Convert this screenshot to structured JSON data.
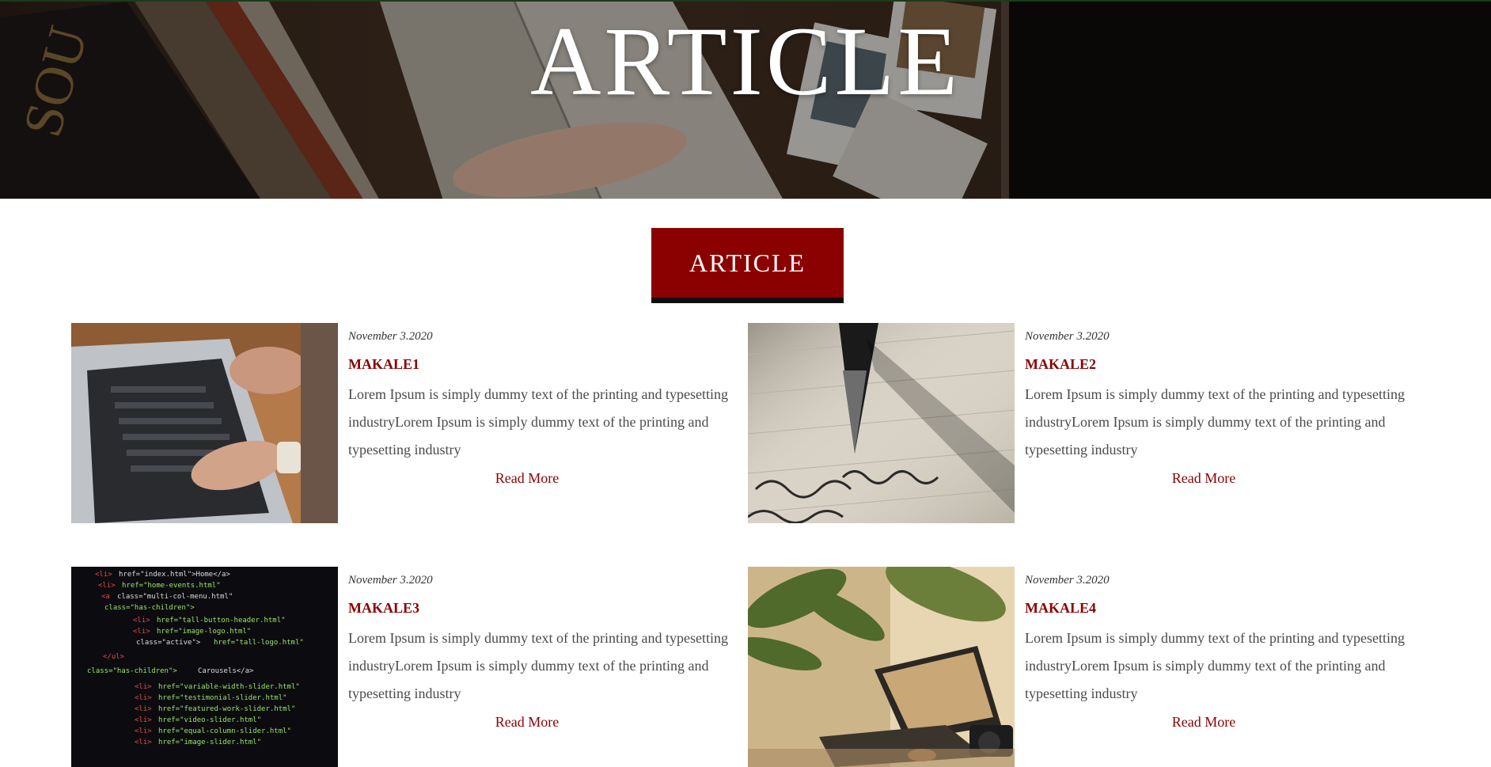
{
  "hero": {
    "title": "ARTICLE"
  },
  "section": {
    "badge_label": "ARTICLE"
  },
  "colors": {
    "accent": "#8b0000",
    "text": "#4a4a4a"
  },
  "articles": [
    {
      "date": "November 3.2020",
      "title": "MAKALE1",
      "text": "Lorem Ipsum is simply dummy text of the printing and typesetting industryLorem Ipsum is simply dummy text of the printing and typesetting industry",
      "link_label": "Read More",
      "image": "laptop-typing-photo"
    },
    {
      "date": "November 3.2020",
      "title": "MAKALE2",
      "text": "Lorem Ipsum is simply dummy text of the printing and typesetting industryLorem Ipsum is simply dummy text of the printing and typesetting industry",
      "link_label": "Read More",
      "image": "fountain-pen-writing-photo"
    },
    {
      "date": "November 3.2020",
      "title": "MAKALE3",
      "text": "Lorem Ipsum is simply dummy text of the printing and typesetting industryLorem Ipsum is simply dummy text of the printing and typesetting industry",
      "link_label": "Read More",
      "image": "html-code-screen-photo"
    },
    {
      "date": "November 3.2020",
      "title": "MAKALE4",
      "text": "Lorem Ipsum is simply dummy text of the printing and typesetting industryLorem Ipsum is simply dummy text of the printing and typesetting industry",
      "link_label": "Read More",
      "image": "laptop-plants-desk-photo"
    }
  ]
}
